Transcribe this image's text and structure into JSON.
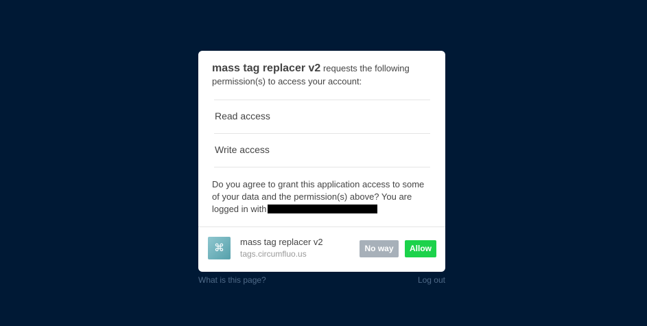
{
  "dialog": {
    "app_name": "mass tag replacer v2",
    "intro_text": " requests the following permission(s) to access your account:",
    "permissions": [
      "Read access",
      "Write access"
    ],
    "consent_text": "Do you agree to grant this application access to some of your data and the permission(s) above? You are logged in with",
    "app_icon": "command-icon",
    "app_title": "mass tag replacer v2",
    "app_domain": "tags.circumfluo.us",
    "deny_label": "No way",
    "allow_label": "Allow"
  },
  "links": {
    "help": "What is this page?",
    "logout": "Log out"
  },
  "colors": {
    "background": "#001935",
    "allow": "#1cd24b",
    "deny": "#a7b0b9"
  }
}
